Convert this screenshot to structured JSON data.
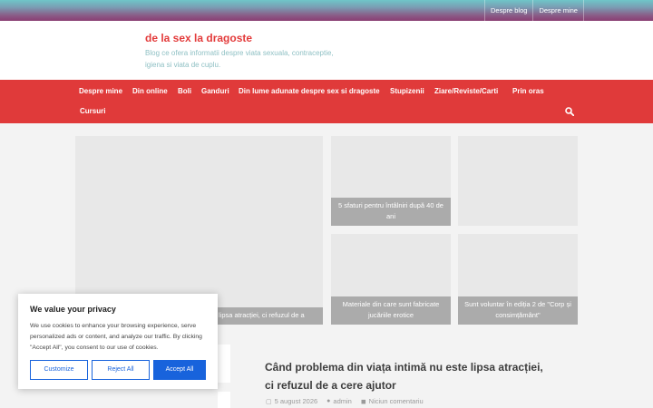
{
  "topbar": {
    "links": [
      "Despre blog",
      "Despre mine"
    ]
  },
  "header": {
    "title": "de la sex la dragoste",
    "tagline": "Blog ce ofera informatii despre viata sexuala, contraceptie, igiena si viata de cuplu."
  },
  "nav": {
    "items": [
      "Despre mine",
      "Din online",
      "Boli",
      "Ganduri",
      "Din lume adunate despre sex si dragoste",
      "Stupizenii",
      "Ziare/Reviste/Carti",
      "Prin oras",
      "Cursuri"
    ]
  },
  "featured": {
    "tiles": [
      "lipsa atracției, ci refuzul de a",
      "5 sfaturi pentru întâlniri după 40 de ani",
      "",
      "Materiale din care sunt fabricate jucăriile erotice",
      "Sunt voluntar în ediția 2 de \"Corp și consimțământ\""
    ]
  },
  "post": {
    "title": "Când problema din viața intimă nu este lipsa atracției, ci refuzul de a cere ajutor",
    "date": "5 august 2026",
    "author": "admin",
    "comments": "Niciun comentariu"
  },
  "cookie": {
    "title": "We value your privacy",
    "text": "We use cookies to enhance your browsing experience, serve personalized ads or content, and analyze our traffic. By clicking \"Accept All\", you consent to our use of cookies.",
    "customize": "Customize",
    "reject": "Reject All",
    "accept": "Accept All"
  }
}
